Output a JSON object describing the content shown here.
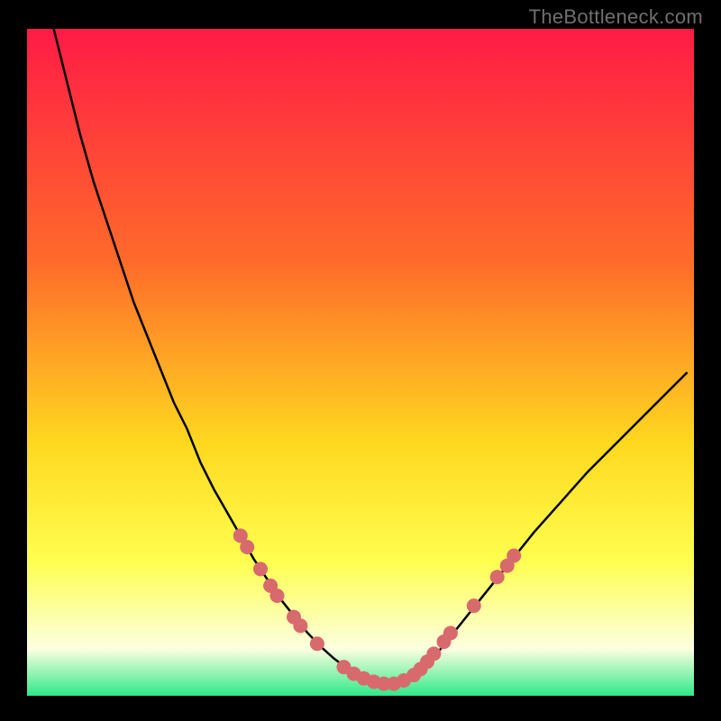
{
  "watermark": "TheBottleneck.com",
  "colors": {
    "gradient_top": "#ff1b46",
    "gradient_mid1": "#ff6b2a",
    "gradient_mid2": "#ffd81f",
    "gradient_mid3": "#ffff50",
    "gradient_mid4": "#fcffe0",
    "gradient_bottom": "#2fe989",
    "curve": "#000000",
    "dot": "#d86a6d",
    "frame": "#000000"
  },
  "chart_data": {
    "type": "line",
    "title": "",
    "xlabel": "",
    "ylabel": "",
    "xlim": [
      0,
      100
    ],
    "ylim": [
      0,
      100
    ],
    "series": [
      {
        "name": "bottleneck-curve",
        "x": [
          4,
          6,
          8,
          10,
          12,
          14,
          16,
          18,
          20,
          22,
          24,
          26,
          28,
          30,
          32,
          34,
          36,
          38,
          40,
          42,
          44,
          46,
          48,
          50,
          52,
          54,
          56,
          58,
          60,
          62,
          64,
          68,
          72,
          76,
          80,
          84,
          88,
          92,
          96,
          99
        ],
        "values": [
          100,
          92,
          84,
          77,
          71,
          65,
          59,
          54,
          49,
          44,
          40,
          35,
          31,
          27.5,
          24,
          20.5,
          17.5,
          14.5,
          12,
          9.5,
          7.4,
          5.6,
          4.1,
          2.9,
          2.1,
          1.7,
          2.0,
          3.0,
          4.8,
          7.0,
          9.5,
          14.5,
          19.5,
          24.5,
          29.0,
          33.5,
          37.5,
          41.5,
          45.5,
          48.5
        ]
      }
    ],
    "dots": [
      {
        "x": 32.0,
        "y": 24.0
      },
      {
        "x": 33.0,
        "y": 22.3
      },
      {
        "x": 35.0,
        "y": 19.0
      },
      {
        "x": 36.5,
        "y": 16.5
      },
      {
        "x": 37.5,
        "y": 15.0
      },
      {
        "x": 40.0,
        "y": 11.8
      },
      {
        "x": 41.0,
        "y": 10.5
      },
      {
        "x": 43.5,
        "y": 7.8
      },
      {
        "x": 47.5,
        "y": 4.3
      },
      {
        "x": 49.0,
        "y": 3.3
      },
      {
        "x": 50.5,
        "y": 2.6
      },
      {
        "x": 52.0,
        "y": 2.1
      },
      {
        "x": 53.5,
        "y": 1.8
      },
      {
        "x": 55.0,
        "y": 1.8
      },
      {
        "x": 56.5,
        "y": 2.3
      },
      {
        "x": 58.0,
        "y": 3.1
      },
      {
        "x": 59.0,
        "y": 4.0
      },
      {
        "x": 60.0,
        "y": 5.1
      },
      {
        "x": 61.0,
        "y": 6.3
      },
      {
        "x": 62.5,
        "y": 8.1
      },
      {
        "x": 63.5,
        "y": 9.4
      },
      {
        "x": 67.0,
        "y": 13.5
      },
      {
        "x": 70.5,
        "y": 17.8
      },
      {
        "x": 72.0,
        "y": 19.5
      },
      {
        "x": 73.0,
        "y": 21.0
      }
    ]
  }
}
